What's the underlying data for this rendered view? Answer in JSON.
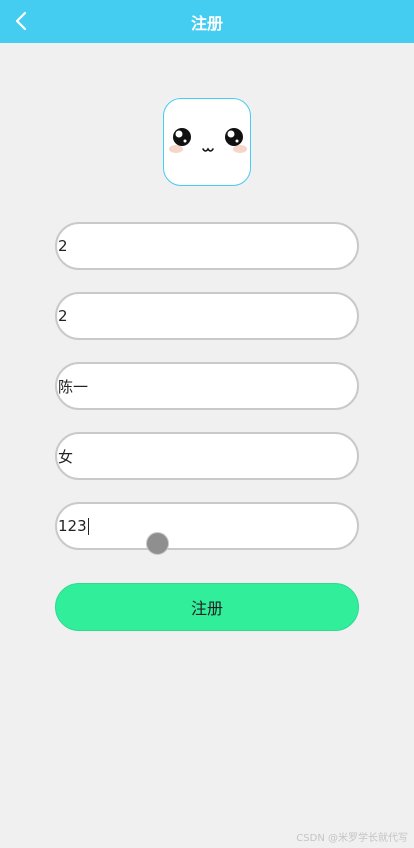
{
  "header": {
    "title": "注册",
    "back_icon": "chevron-left-icon",
    "background": "#45cdf1"
  },
  "avatar": {
    "icon": "kawaii-face-icon"
  },
  "form": {
    "fields": [
      {
        "value": "2"
      },
      {
        "value": "2"
      },
      {
        "value": "陈一"
      },
      {
        "value": "女"
      },
      {
        "value": "123"
      }
    ],
    "submit_label": "注册",
    "submit_color": "#31ee9a"
  },
  "watermark": "CSDN @米罗学长就代写"
}
